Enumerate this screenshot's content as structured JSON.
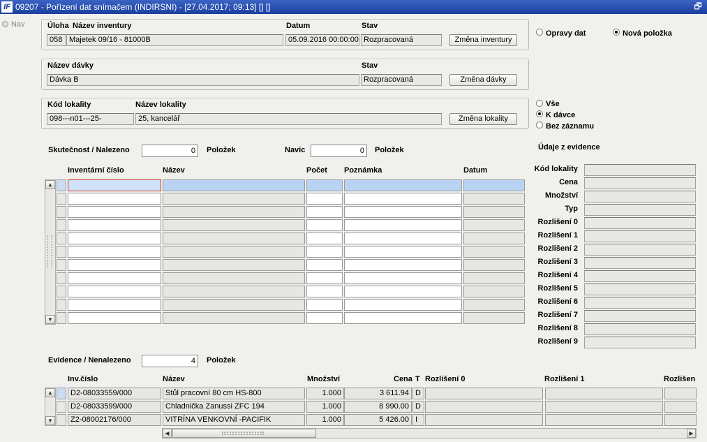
{
  "window": {
    "title": "09207 - Pořízení dat snímačem (INDIRSNI) - [27.04.2017; 09:13] [] []",
    "logo_text": "IF",
    "restore_glyph": "🗗",
    "nav_label": "Nav"
  },
  "inventory": {
    "label_uloha": "Úloha",
    "label_nazev": "Název inventury",
    "label_datum": "Datum",
    "label_stav": "Stav",
    "uloha": "058",
    "nazev": "Majetek 09/16 - 81000B",
    "datum": "05.09.2016 00:00:00",
    "stav": "Rozpracovaná",
    "button": "Změna inventury"
  },
  "batch": {
    "label_nazev": "Název dávky",
    "label_stav": "Stav",
    "nazev": "Dávka B",
    "stav": "Rozpracovaná",
    "button": "Změna dávky"
  },
  "locality": {
    "label_kod": "Kód lokality",
    "label_nazev": "Název lokality",
    "kod": "098---n01---25-",
    "nazev": "25, kancelář",
    "button": "Změna lokality"
  },
  "mode_radios": {
    "opravy": "Opravy dat",
    "nova": "Nová položka",
    "selected": "nova"
  },
  "filter_radios": {
    "vse": "Vše",
    "k_davce": "K dávce",
    "bez": "Bez záznamu",
    "selected": "k_davce"
  },
  "counts": {
    "skutecnost_label": "Skutečnost / Nalezeno",
    "skutecnost_value": "0",
    "polozek1": "Položek",
    "navic_label": "Navíc",
    "navic_value": "0",
    "polozek2": "Položek",
    "evidence_label": "Evidence / Nenalezeno",
    "evidence_value": "4",
    "polozek3": "Položek"
  },
  "grid1": {
    "headers": [
      "Inventární číslo",
      "Název",
      "Počet",
      "Poznámka",
      "Datum"
    ],
    "row_count": 11
  },
  "evidence_panel": {
    "title": "Údaje z evidence",
    "labels": [
      "Kód lokality",
      "Cena",
      "Množství",
      "Typ",
      "Rozlišení 0",
      "Rozlišení 1",
      "Rozlišení 2",
      "Rozlišení 3",
      "Rozlišení 4",
      "Rozlišení 5",
      "Rozlišení 6",
      "Rozlišení 7",
      "Rozlišení 8",
      "Rozlišení 9"
    ]
  },
  "grid2": {
    "headers": [
      "Inv.číslo",
      "Název",
      "Množství",
      "Cena",
      "T",
      "Rozlišení 0",
      "Rozlišení 1",
      "Rozlišen"
    ],
    "rows": [
      {
        "inv": "D2-08033559/000",
        "nazev": "Stůl pracovní 80 cm HS-800",
        "mnozstvi": "1.000",
        "cena": "3 611.94",
        "t": "D"
      },
      {
        "inv": "D2-08033599/000",
        "nazev": "Chladnička Zanussi ZFC 194",
        "mnozstvi": "1.000",
        "cena": "8 990.00",
        "t": "D"
      },
      {
        "inv": "Z2-08002176/000",
        "nazev": "VITRÍNA VENKOVNÍ -PACIFIK",
        "mnozstvi": "1.000",
        "cena": "5 426.00",
        "t": "I"
      }
    ]
  }
}
